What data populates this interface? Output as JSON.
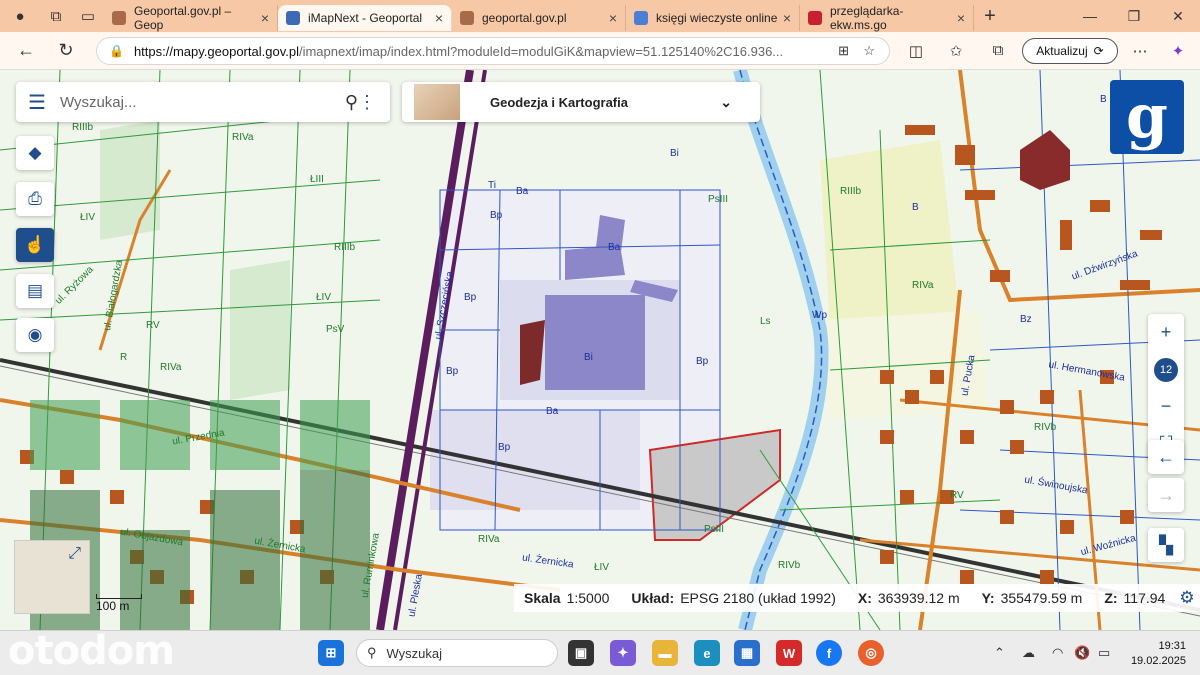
{
  "browser": {
    "tabs": [
      {
        "label": "Geoportal.gov.pl – Geop",
        "active": false
      },
      {
        "label": "iMapNext - Geoportal",
        "active": true
      },
      {
        "label": "geoportal.gov.pl",
        "active": false
      },
      {
        "label": "księgi wieczyste online",
        "active": false
      },
      {
        "label": "przeglądarka-ekw.ms.go",
        "active": false
      }
    ],
    "url_host": "https://mapy.geoportal.gov.pl",
    "url_rest": "/imapnext/imap/index.html?moduleId=modulGiK&mapview=51.125140%2C16.936...",
    "update_label": "Aktualizuj"
  },
  "map": {
    "search_placeholder": "Wyszukaj...",
    "module_label": "Geodezja i Kartografia",
    "zoom_level": "12",
    "scale_bar_label": "100 m",
    "status": {
      "scale_label": "Skala",
      "scale_value": "1:5000",
      "system_label": "Układ:",
      "system_value": "EPSG 2180 (układ 1992)",
      "x_label": "X:",
      "x_value": "363939.12 m",
      "y_label": "Y:",
      "y_value": "355479.59 m",
      "z_label": "Z:",
      "z_value": "117.94"
    },
    "labels": {
      "l1": "RIIIb",
      "l2": "RIVa",
      "l3": "ŁIII",
      "l4": "RIVb",
      "l5": "ŁIV",
      "l6": "ul. Ryżowa",
      "l7": "ul. Białogardzka",
      "l8": "RV",
      "l9": "R",
      "l10": "RIVa",
      "l11": "RIIIb",
      "l12": "ŁIV",
      "l13": "PsV",
      "l14": "ul. Szczecińska",
      "l15": "Bi",
      "l16": "Ba",
      "l17": "Bp",
      "l18": "Ti",
      "l19": "Bp",
      "l20": "Ba",
      "l21": "Bi",
      "l22": "Bp",
      "l23": "Bp",
      "l24": "Ba",
      "l25": "Bp",
      "l26": "PsIII",
      "l27": "Ls",
      "l28": "Wp",
      "l29": "RIIIb",
      "l30": "B",
      "l31": "RIVa",
      "l32": "ul. Dźwirzyńska",
      "l33": "Bz",
      "l34": "ul. Pucka",
      "l35": "ul. Hermanowska",
      "l36": "RIVb",
      "l37": "RV",
      "l38": "ul. Przednia",
      "l39": "ul. Żernicka",
      "l40": "ul. Objazdowa",
      "l41": "ul. Ruminkowa",
      "l42": "ul. Pleska",
      "l43": "RIVa",
      "l44": "ŁIV",
      "l45": "PsIII",
      "l46": "ul. Żernicka",
      "l47": "RIVb",
      "l48": "ul. Świnoujska",
      "l49": "ul. Woźnicka",
      "l50": "B"
    }
  },
  "taskbar": {
    "search_label": "Wyszukaj",
    "time": "19:31",
    "date": "19.02.2025"
  },
  "watermark": "otodom",
  "colors": {
    "accent": "#1f4e8c",
    "tabbar": "#f7c8a6",
    "logo": "#0d4ea6"
  }
}
